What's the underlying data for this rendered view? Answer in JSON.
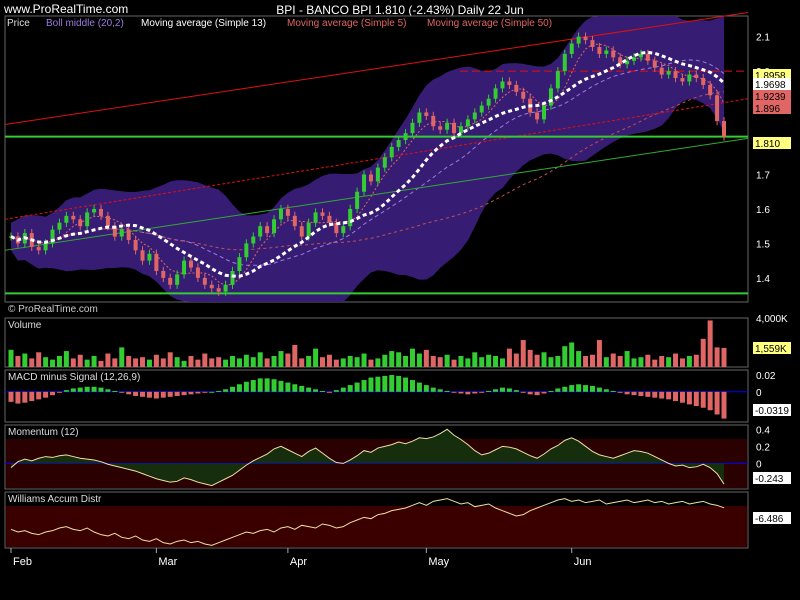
{
  "header": {
    "brand": "www.ProRealTime.com",
    "title": "BPI - BANCO BPI    1.810 (-2.43%)    Daily  22 Jun"
  },
  "legend": {
    "price": "Price",
    "boll": "Boll middle (20,2)",
    "ma13": "Moving average (Simple 13)",
    "ma5": "Moving average (Simple 5)",
    "ma50": "Moving average (Simple 50)"
  },
  "watermark": "© ProRealTime.com",
  "colors": {
    "bg": "#000000",
    "up": "#33cc33",
    "down": "#e06666",
    "band": "#3a1e7a",
    "ma13": "#ffffff",
    "trend_red": "#e01010",
    "trend_green": "#33aa33",
    "support": "#33cc33",
    "macd_line": "#0000ff",
    "panel_border": "#666666",
    "williams_fill": "#3a0000"
  },
  "chart_data": [
    {
      "type": "candlestick",
      "name": "Price",
      "ylim": [
        1.33,
        2.16
      ],
      "y_ticks": [
        "2.1",
        "2.0",
        "1.9",
        "1.8",
        "1.7",
        "1.6",
        "1.5",
        "1.4"
      ],
      "x_ticks": [
        "Feb",
        "Mar",
        "Apr",
        "May",
        "Jun"
      ],
      "sessions": 104,
      "closes": [
        1.52,
        1.5,
        1.53,
        1.49,
        1.48,
        1.5,
        1.54,
        1.56,
        1.58,
        1.57,
        1.55,
        1.59,
        1.6,
        1.58,
        1.55,
        1.52,
        1.54,
        1.51,
        1.48,
        1.45,
        1.47,
        1.42,
        1.4,
        1.38,
        1.41,
        1.45,
        1.43,
        1.4,
        1.38,
        1.37,
        1.36,
        1.38,
        1.42,
        1.46,
        1.5,
        1.52,
        1.55,
        1.53,
        1.57,
        1.6,
        1.58,
        1.55,
        1.52,
        1.56,
        1.59,
        1.58,
        1.56,
        1.53,
        1.55,
        1.6,
        1.65,
        1.7,
        1.68,
        1.72,
        1.75,
        1.78,
        1.8,
        1.82,
        1.85,
        1.88,
        1.87,
        1.84,
        1.83,
        1.85,
        1.82,
        1.84,
        1.86,
        1.88,
        1.9,
        1.92,
        1.95,
        1.97,
        1.96,
        1.94,
        1.92,
        1.88,
        1.86,
        1.9,
        1.95,
        2.0,
        2.05,
        2.08,
        2.1,
        2.09,
        2.07,
        2.05,
        2.06,
        2.04,
        2.02,
        2.03,
        2.04,
        2.05,
        2.03,
        2.01,
        1.99,
        2.0,
        1.98,
        1.97,
        1.99,
        1.98,
        1.96,
        1.93,
        1.855,
        1.81
      ],
      "ma13_last": 1.8958,
      "bands_last": {
        "upper": 1.9239,
        "middle": 1.896
      },
      "support_level": 1.81,
      "low_support": 1.355,
      "value_labels": [
        "1.8958",
        "1.9698",
        "1.9239",
        "1.896",
        "1.810"
      ]
    },
    {
      "type": "bar",
      "name": "Volume",
      "y_ticks": [
        "4,000K"
      ],
      "last_label": "1,559K",
      "ylim": [
        0,
        4000
      ],
      "values": [
        1400,
        900,
        1100,
        700,
        1200,
        800,
        600,
        900,
        1300,
        700,
        1000,
        600,
        900,
        500,
        1100,
        700,
        1600,
        900,
        700,
        800,
        600,
        1000,
        700,
        1200,
        800,
        500,
        900,
        600,
        1100,
        700,
        800,
        600,
        900,
        700,
        1000,
        800,
        1200,
        700,
        900,
        1300,
        1100,
        1800,
        700,
        900,
        1500,
        800,
        1000,
        600,
        700,
        900,
        800,
        1100,
        600,
        700,
        1000,
        1300,
        1200,
        900,
        1500,
        1100,
        1400,
        900,
        800,
        1000,
        600,
        900,
        700,
        1200,
        800,
        1000,
        900,
        700,
        1500,
        1100,
        2200,
        1400,
        1000,
        1200,
        800,
        900,
        1700,
        2000,
        1300,
        900,
        1000,
        2200,
        800,
        1100,
        900,
        1300,
        700,
        800,
        1000,
        600,
        900,
        800,
        1100,
        700,
        900,
        1000,
        2300,
        3800,
        1600,
        1559
      ]
    },
    {
      "type": "bar",
      "name": "MACD minus Signal (12,26,9)",
      "y_ticks": [
        "0.02",
        "0"
      ],
      "last_label": "-0.0319",
      "ylim": [
        -0.036,
        0.026
      ],
      "values": [
        -0.012,
        -0.014,
        -0.013,
        -0.011,
        -0.009,
        -0.007,
        -0.004,
        -0.001,
        0.002,
        0.004,
        0.005,
        0.006,
        0.006,
        0.005,
        0.003,
        0.001,
        -0.001,
        -0.003,
        -0.005,
        -0.006,
        -0.007,
        -0.008,
        -0.007,
        -0.006,
        -0.005,
        -0.004,
        -0.003,
        -0.002,
        -0.001,
        0.0,
        0.001,
        0.003,
        0.006,
        0.009,
        0.012,
        0.014,
        0.016,
        0.016,
        0.015,
        0.013,
        0.011,
        0.009,
        0.007,
        0.005,
        0.003,
        0.001,
        -0.001,
        0.002,
        0.005,
        0.008,
        0.011,
        0.014,
        0.017,
        0.018,
        0.019,
        0.02,
        0.019,
        0.017,
        0.014,
        0.011,
        0.008,
        0.005,
        0.003,
        0.001,
        -0.001,
        -0.002,
        -0.003,
        -0.002,
        -0.001,
        0.001,
        0.003,
        0.005,
        0.004,
        0.002,
        -0.001,
        -0.003,
        -0.004,
        -0.002,
        0.001,
        0.004,
        0.006,
        0.008,
        0.009,
        0.008,
        0.007,
        0.005,
        0.003,
        0.001,
        -0.001,
        -0.003,
        -0.004,
        -0.005,
        -0.006,
        -0.007,
        -0.008,
        -0.009,
        -0.011,
        -0.013,
        -0.015,
        -0.017,
        -0.019,
        -0.022,
        -0.027,
        -0.0319
      ]
    },
    {
      "type": "line",
      "name": "Momentum (12)",
      "y_ticks": [
        "0.4",
        "0.2",
        "0"
      ],
      "last_label": "-0.243",
      "ylim": [
        -0.3,
        0.45
      ],
      "values": [
        -0.05,
        0.02,
        0.05,
        0.03,
        0.06,
        0.08,
        0.07,
        0.09,
        0.1,
        0.08,
        0.06,
        0.05,
        0.04,
        0.02,
        -0.01,
        -0.03,
        -0.05,
        -0.07,
        -0.09,
        -0.12,
        -0.15,
        -0.18,
        -0.2,
        -0.22,
        -0.21,
        -0.17,
        -0.19,
        -0.22,
        -0.24,
        -0.26,
        -0.22,
        -0.18,
        -0.14,
        -0.08,
        -0.02,
        0.03,
        0.07,
        0.11,
        0.17,
        0.2,
        0.16,
        0.12,
        0.08,
        0.14,
        0.18,
        0.12,
        0.06,
        0.01,
        0.0,
        0.04,
        0.09,
        0.15,
        0.13,
        0.18,
        0.2,
        0.22,
        0.25,
        0.23,
        0.26,
        0.3,
        0.29,
        0.31,
        0.35,
        0.4,
        0.33,
        0.28,
        0.22,
        0.15,
        0.1,
        0.12,
        0.16,
        0.2,
        0.19,
        0.17,
        0.13,
        0.09,
        0.06,
        0.11,
        0.17,
        0.21,
        0.27,
        0.3,
        0.26,
        0.2,
        0.14,
        0.1,
        0.08,
        0.06,
        0.09,
        0.12,
        0.15,
        0.14,
        0.12,
        0.08,
        0.04,
        0.0,
        -0.03,
        -0.02,
        -0.05,
        -0.04,
        -0.01,
        -0.05,
        -0.12,
        -0.243
      ]
    },
    {
      "type": "line",
      "name": "Williams Accum Distr",
      "y_ticks": [],
      "last_label": "-6.486",
      "ylim": [
        -9.5,
        -5.3
      ],
      "values": [
        -8.1,
        -8.3,
        -8.2,
        -8.4,
        -8.5,
        -8.3,
        -8.2,
        -8.0,
        -7.9,
        -8.1,
        -8.2,
        -8.0,
        -8.3,
        -8.5,
        -8.6,
        -8.4,
        -8.7,
        -8.8,
        -8.6,
        -8.9,
        -9.0,
        -8.8,
        -9.1,
        -9.2,
        -9.0,
        -8.9,
        -9.1,
        -9.0,
        -9.2,
        -9.3,
        -9.1,
        -8.9,
        -8.7,
        -8.5,
        -8.3,
        -8.4,
        -8.2,
        -8.1,
        -8.3,
        -8.0,
        -7.9,
        -8.1,
        -7.8,
        -7.9,
        -8.0,
        -7.7,
        -7.8,
        -8.0,
        -7.9,
        -7.6,
        -7.4,
        -7.2,
        -7.3,
        -7.0,
        -6.9,
        -6.7,
        -6.6,
        -6.5,
        -6.3,
        -6.1,
        -6.3,
        -6.0,
        -5.9,
        -5.8,
        -6.0,
        -6.2,
        -6.1,
        -6.4,
        -6.3,
        -6.2,
        -6.5,
        -6.7,
        -6.9,
        -7.1,
        -7.0,
        -6.7,
        -6.5,
        -6.3,
        -6.1,
        -5.9,
        -5.8,
        -6.0,
        -5.9,
        -6.1,
        -6.0,
        -5.9,
        -6.2,
        -6.1,
        -6.0,
        -5.9,
        -6.1,
        -6.0,
        -5.9,
        -6.1,
        -6.0,
        -6.2,
        -6.1,
        -6.0,
        -6.2,
        -6.1,
        -6.0,
        -6.2,
        -6.3,
        -6.486
      ]
    }
  ]
}
